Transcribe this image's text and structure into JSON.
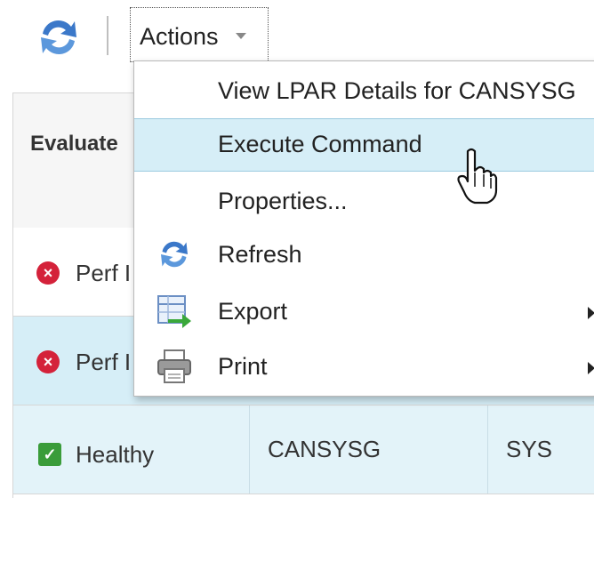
{
  "toolbar": {
    "refresh_icon": "refresh-icon",
    "actions_label": "Actions",
    "actions_caret_icon": "chevron-down-icon"
  },
  "grid": {
    "columns": [
      "Evaluate"
    ],
    "rows": [
      {
        "status": "Perf I",
        "status_type": "error",
        "cells": []
      },
      {
        "status": "Perf I",
        "status_type": "error",
        "cells": []
      },
      {
        "status": "Healthy",
        "status_type": "ok",
        "cells": [
          "CANSYSG",
          "SYS"
        ]
      }
    ]
  },
  "menu": {
    "items": [
      {
        "label": "View LPAR Details for CANSYSG",
        "icon": null,
        "submenu": false
      },
      {
        "label": "Execute Command",
        "icon": null,
        "submenu": false,
        "hovered": true
      },
      {
        "label": "Properties...",
        "icon": null,
        "submenu": false
      },
      {
        "label": "Refresh",
        "icon": "refresh-icon",
        "submenu": false
      },
      {
        "label": "Export",
        "icon": "export-icon",
        "submenu": true
      },
      {
        "label": "Print",
        "icon": "printer-icon",
        "submenu": true
      }
    ]
  },
  "colors": {
    "error": "#d4223a",
    "ok": "#3a9c3a",
    "selected_row": "#d6eef7",
    "hover_item": "#d6eef7",
    "refresh_blue": "#3b78c9"
  }
}
